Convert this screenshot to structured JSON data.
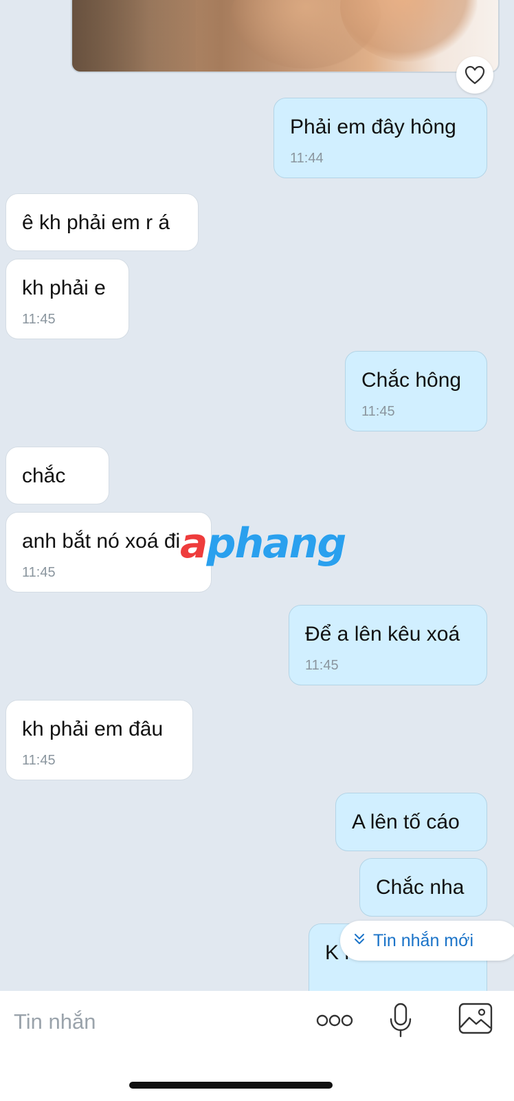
{
  "messages": [
    {
      "direction": "outgoing",
      "text": "Phải em đây hông",
      "time": "11:44"
    },
    {
      "direction": "incoming",
      "text": "ê kh phải em r á",
      "time": ""
    },
    {
      "direction": "incoming",
      "text": "kh phải e",
      "time": "11:45"
    },
    {
      "direction": "outgoing",
      "text": "Chắc hông",
      "time": "11:45"
    },
    {
      "direction": "incoming",
      "text": "chắc",
      "time": ""
    },
    {
      "direction": "incoming",
      "text": "anh bắt nó xoá đi",
      "time": "11:45"
    },
    {
      "direction": "outgoing",
      "text": "Để a lên kêu xoá",
      "time": "11:45"
    },
    {
      "direction": "incoming",
      "text": "kh phải em đâu",
      "time": "11:45"
    },
    {
      "direction": "outgoing",
      "text": "A lên tố cáo",
      "time": ""
    },
    {
      "direction": "outgoing",
      "text": "Chắc nha",
      "time": ""
    },
    {
      "direction": "outgoing",
      "text": "K nó chửi a đó",
      "time": ""
    }
  ],
  "photo_message": {
    "reaction_icon": "heart-outline-icon"
  },
  "watermark": {
    "accent": "a",
    "rest": "phang"
  },
  "new_message_button": {
    "icon": "double-chevron-down-icon",
    "label": "Tin nhắn mới"
  },
  "composer": {
    "placeholder": "Tin nhắn",
    "icons": [
      "more-icon",
      "microphone-icon",
      "image-icon"
    ]
  },
  "colors": {
    "background": "#e1e8f0",
    "outgoing_bubble": "#d1efff",
    "incoming_bubble": "#ffffff",
    "timestamp": "#8a959e",
    "accent_blue": "#1a73c8"
  }
}
